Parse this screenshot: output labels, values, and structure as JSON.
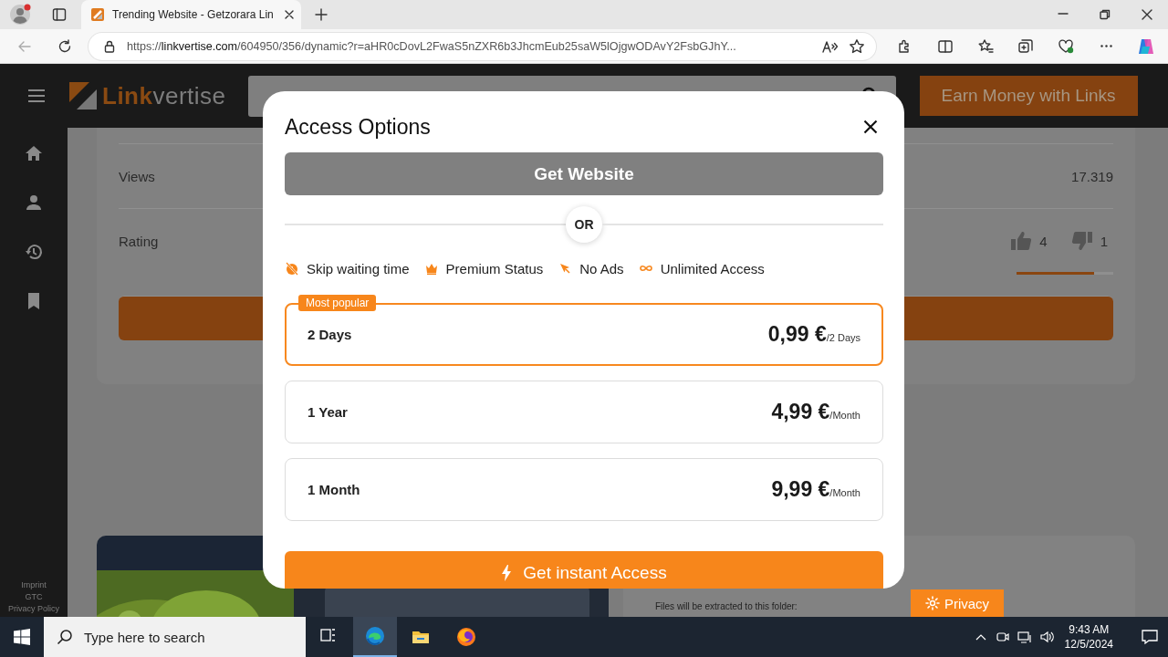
{
  "browser": {
    "tab": {
      "title": "Trending Website - Getzorara Lin"
    },
    "address": {
      "url": "https://linkvertise.com/604950/356/dynamic?r=aHR0cDovL2FwaS5nZXR6b3JhcmEub25saW5lOjgwODAvY2FsbGJhY..."
    }
  },
  "site": {
    "header": {
      "logo": {
        "accent": "Link",
        "rest": "vertise"
      },
      "cta": "Earn Money with Links"
    },
    "sidebar": {
      "footer_links": [
        "Imprint",
        "GTC",
        "Privacy Policy"
      ]
    },
    "stats": [
      {
        "kind": "text",
        "label": "Views",
        "value": "17.319"
      },
      {
        "kind": "rating",
        "label": "Rating",
        "likes": "4",
        "dislikes": "1",
        "level": 0.8
      }
    ],
    "files_text": "Files will be extracted to this folder:",
    "privacy_button": "Privacy"
  },
  "modal": {
    "title": "Access Options",
    "primary_button": "Get Website",
    "divider": "OR",
    "features": [
      {
        "label": "Skip waiting time"
      },
      {
        "label": "Premium Status"
      },
      {
        "label": "No Ads"
      },
      {
        "label": "Unlimited Access"
      }
    ],
    "plans": [
      {
        "name": "2 Days",
        "price": "0,99 €",
        "period": "/2 Days",
        "badge": "Most popular",
        "selected": true
      },
      {
        "name": "1 Year",
        "price": "4,99 €",
        "period": "/Month",
        "selected": false
      },
      {
        "name": "1 Month",
        "price": "9,99 €",
        "period": "/Month",
        "selected": false
      }
    ],
    "action_button": "Get instant Access"
  },
  "taskbar": {
    "search_placeholder": "Type here to search",
    "time": "9:43 AM",
    "date": "12/5/2024"
  }
}
